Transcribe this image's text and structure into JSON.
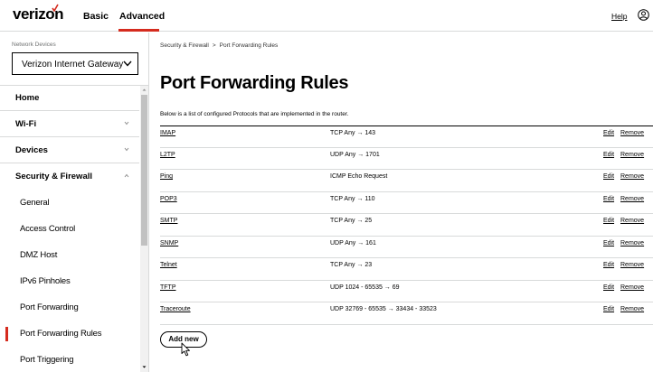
{
  "header": {
    "logo_text": "verizon",
    "tabs": [
      {
        "label": "Basic",
        "active": false
      },
      {
        "label": "Advanced",
        "active": true
      }
    ],
    "help_label": "Help",
    "user_icon": "user-circle-icon",
    "accent_color": "#d52b1e"
  },
  "sidebar": {
    "network_devices_label": "Network Devices",
    "device_select_value": "Verizon Internet Gateway",
    "items": [
      {
        "label": "Home"
      },
      {
        "label": "Wi-Fi",
        "icon": "chevron-down-icon"
      },
      {
        "label": "Devices",
        "icon": "chevron-down-icon"
      },
      {
        "label": "Security & Firewall",
        "icon": "chevron-up-icon"
      }
    ],
    "subitems": [
      {
        "label": "General",
        "active": false
      },
      {
        "label": "Access Control",
        "active": false
      },
      {
        "label": "DMZ Host",
        "active": false
      },
      {
        "label": "IPv6 Pinholes",
        "active": false
      },
      {
        "label": "Port Forwarding",
        "active": false
      },
      {
        "label": "Port Forwarding Rules",
        "active": true
      },
      {
        "label": "Port Triggering",
        "active": false
      }
    ]
  },
  "main": {
    "breadcrumb": {
      "parent": "Security & Firewall",
      "separator": ">",
      "current": "Port Forwarding Rules"
    },
    "title": "Port Forwarding Rules",
    "intro": "Below is a list of configured Protocols that are implemented in the router.",
    "edit_label": "Edit",
    "remove_label": "Remove",
    "rules": [
      {
        "name": "IMAP",
        "desc": "TCP Any → 143"
      },
      {
        "name": "L2TP",
        "desc": "UDP Any → 1701"
      },
      {
        "name": "Ping",
        "desc": "ICMP Echo Request"
      },
      {
        "name": "POP3",
        "desc": "TCP Any → 110"
      },
      {
        "name": "SMTP",
        "desc": "TCP Any → 25"
      },
      {
        "name": "SNMP",
        "desc": "UDP Any → 161"
      },
      {
        "name": "Telnet",
        "desc": "TCP Any → 23"
      },
      {
        "name": "TFTP",
        "desc": "UDP 1024 - 65535 → 69"
      },
      {
        "name": "Traceroute",
        "desc": "UDP 32769 - 65535 → 33434 - 33523"
      }
    ],
    "add_new_label": "Add new"
  }
}
